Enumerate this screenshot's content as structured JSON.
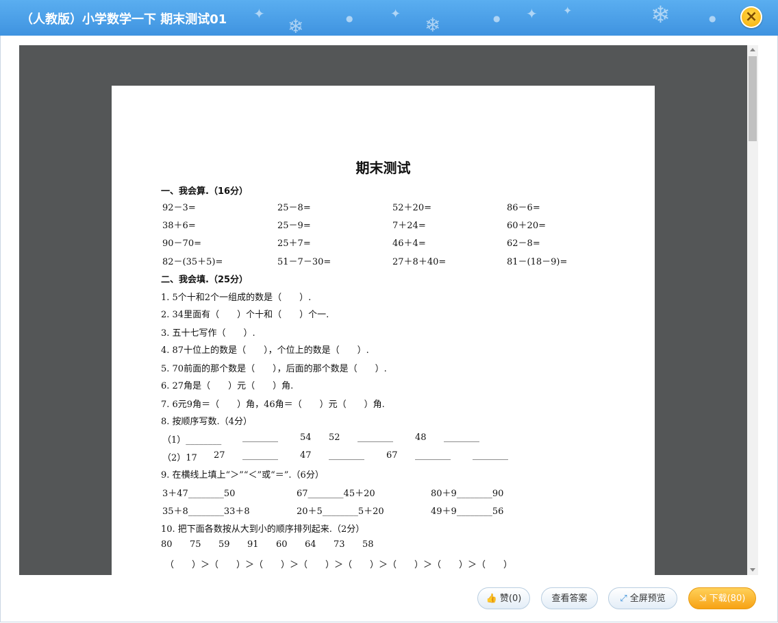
{
  "window": {
    "title": "（人教版）小学数学一下 期末测试01",
    "close_icon": "×"
  },
  "document": {
    "title": "期末测试",
    "section1": {
      "heading": "一、我会算.（16分）",
      "rows": [
        [
          "92－3=",
          "25－8=",
          "52＋20=",
          "86－6="
        ],
        [
          "38＋6=",
          "25－9=",
          "7＋24=",
          "60＋20="
        ],
        [
          "90－70=",
          "25＋7=",
          "46＋4=",
          "62－8="
        ],
        [
          "82－(35＋5)=",
          "51－7－30=",
          "27＋8＋40=",
          "81－(18－9)="
        ]
      ]
    },
    "section2": {
      "heading": "二、我会填.（25分）",
      "items": [
        "1. 5个十和2个一组成的数是（　　）.",
        "2. 34里面有（　　）个十和（　　）个一.",
        "3. 五十七写作（　　）.",
        "4. 87十位上的数是（　　），个位上的数是（　　）.",
        "5. 70前面的那个数是（　　），后面的那个数是（　　）.",
        "6. 27角是（　　）元（　　）角.",
        "7. 6元9角＝（　　）角，46角＝（　　）元（　　）角.",
        "8. 按顺序写数.（4分）"
      ],
      "seq1": [
        "（1）________",
        "________",
        "54",
        "52",
        "________",
        "48",
        "________"
      ],
      "seq2": [
        "（2）17",
        "27",
        "________",
        "47",
        "________",
        "67",
        "________",
        "________"
      ],
      "item9": "9. 在横线上填上“＞”“＜”或“＝”.（6分）",
      "cmp1": [
        "3＋47________50",
        "67________45＋20",
        "80＋9________90"
      ],
      "cmp2": [
        "35＋8________33＋8",
        "20＋5________5＋20",
        "49＋9________56"
      ],
      "item10": "10. 把下面各数按从大到小的顺序排列起来.（2分）",
      "numbers": [
        "80",
        "75",
        "59",
        "91",
        "60",
        "64",
        "73",
        "58"
      ],
      "order": "（　　）＞（　　）＞（　　）＞（　　）＞（　　）＞（　　）＞（　　）＞（　　）"
    }
  },
  "buttons": {
    "like": {
      "label": "赞(0)",
      "icon": "thumbs-up-icon"
    },
    "answer": {
      "label": "查看答案"
    },
    "fullscreen": {
      "label": "全屏预览",
      "icon": "expand-icon"
    },
    "download": {
      "label": "下载(80)",
      "icon": "download-icon"
    }
  }
}
